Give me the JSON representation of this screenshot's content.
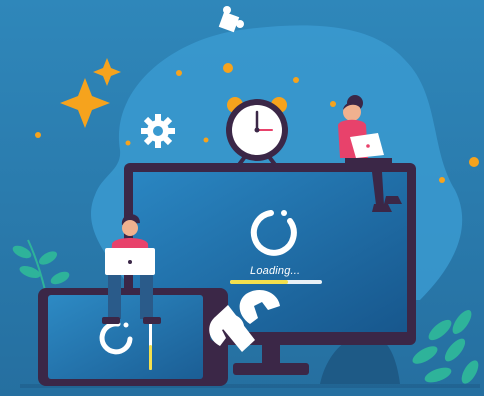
{
  "loading": {
    "label": "Loading..."
  },
  "colors": {
    "background": "#2b82b4",
    "blob": "#3a9ad0",
    "monitor_frame": "#3b2747",
    "screen": "#1f6ea8",
    "accent_orange": "#f6a31d",
    "progress_yellow": "#f4e04d",
    "leaf": "#2eb39a",
    "person_top": "#e8426b"
  },
  "icons": {
    "puzzle": "puzzle-icon",
    "sparkle": "sparkle-icon",
    "gear": "gear-icon",
    "clock": "alarm-clock-icon",
    "spinner": "loading-spinner-icon",
    "wrench": "wrench-icon"
  }
}
